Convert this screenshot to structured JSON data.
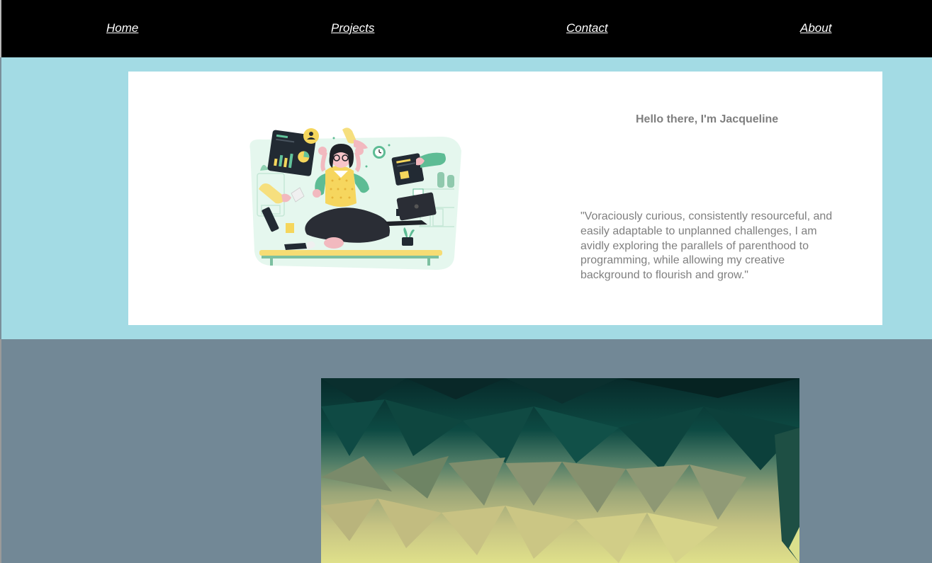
{
  "nav": {
    "items": [
      {
        "label": "Home"
      },
      {
        "label": "Projects"
      },
      {
        "label": "Contact"
      },
      {
        "label": "About"
      }
    ]
  },
  "hero": {
    "greeting": "Hello there, I'm Jacqueline",
    "quote": "\"Voraciously curious, consistently resourceful, and easily adaptable to unplanned challenges, I am avidly exploring the parallels of parenthood to programming, while allowing my creative background to flourish and grow.\""
  },
  "colors": {
    "nav_bg": "#000000",
    "hero_bg": "#a3dbe4",
    "card_bg": "#ffffff",
    "gallery_bg": "#728896",
    "text_muted": "#7f7f7f"
  }
}
